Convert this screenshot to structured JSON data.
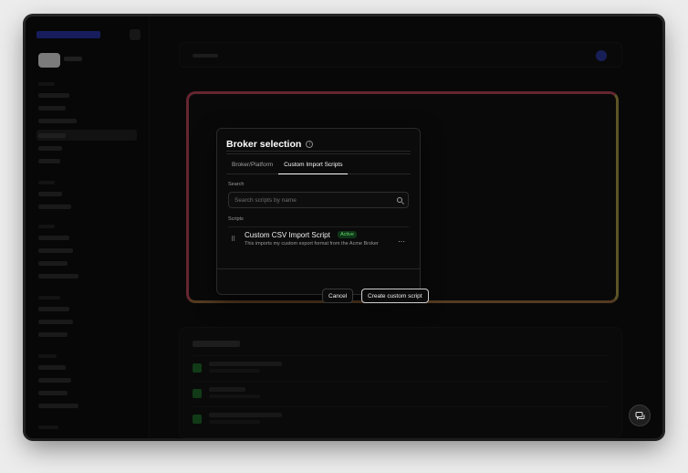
{
  "modal": {
    "title": "Broker selection",
    "info_icon": "info-icon",
    "tabs": [
      {
        "label": "Broker/Platform",
        "active": false
      },
      {
        "label": "Custom Import Scripts",
        "active": true
      }
    ],
    "search": {
      "label": "Search",
      "placeholder": "Search scripts by name",
      "value": ""
    },
    "scripts": {
      "label": "Scripts",
      "items": [
        {
          "name": "Custom CSV Import Script",
          "badge": "Active",
          "description": "This imports my custom export format from the Acme Broker"
        }
      ]
    },
    "actions": {
      "cancel_label": "Cancel",
      "create_label": "Create custom script"
    }
  },
  "colors": {
    "badge_green": "#5ed46a",
    "badge_bg": "#0f3517",
    "accent_blue": "#2c3a9e"
  }
}
